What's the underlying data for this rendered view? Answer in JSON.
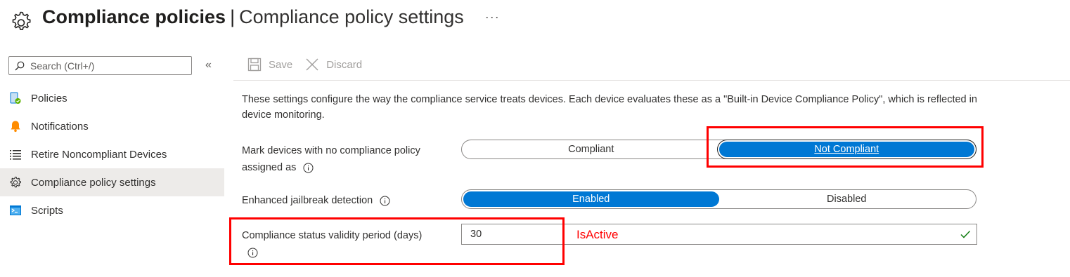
{
  "header": {
    "title_bold": "Compliance policies",
    "title_sep": "|",
    "title_sub": "Compliance policy settings",
    "more": "···"
  },
  "search": {
    "placeholder": "Search (Ctrl+/)"
  },
  "collapse_glyph": "«",
  "sidebar": {
    "items": [
      {
        "label": "Policies",
        "icon": "policies-icon"
      },
      {
        "label": "Notifications",
        "icon": "bell-icon"
      },
      {
        "label": "Retire Noncompliant Devices",
        "icon": "list-icon"
      },
      {
        "label": "Compliance policy settings",
        "icon": "gear-icon",
        "active": true
      },
      {
        "label": "Scripts",
        "icon": "scripts-icon"
      }
    ]
  },
  "toolbar": {
    "save_label": "Save",
    "discard_label": "Discard"
  },
  "description": "These settings configure the way the compliance service treats devices. Each device evaluates these as a \"Built-in Device Compliance Policy\", which is reflected in device monitoring.",
  "settings": {
    "no_policy": {
      "label_line1": "Mark devices with no compliance policy",
      "label_line2": "assigned as",
      "options": [
        "Compliant",
        "Not Compliant"
      ],
      "selected": "Not Compliant"
    },
    "jailbreak": {
      "label": "Enhanced jailbreak detection",
      "options": [
        "Enabled",
        "Disabled"
      ],
      "selected": "Enabled"
    },
    "validity": {
      "label": "Compliance status validity period (days)",
      "value": "30"
    }
  },
  "annotation": {
    "text": "IsActive",
    "color": "#ff0000"
  },
  "colors": {
    "accent": "#0078d4",
    "valid": "#107c10"
  }
}
